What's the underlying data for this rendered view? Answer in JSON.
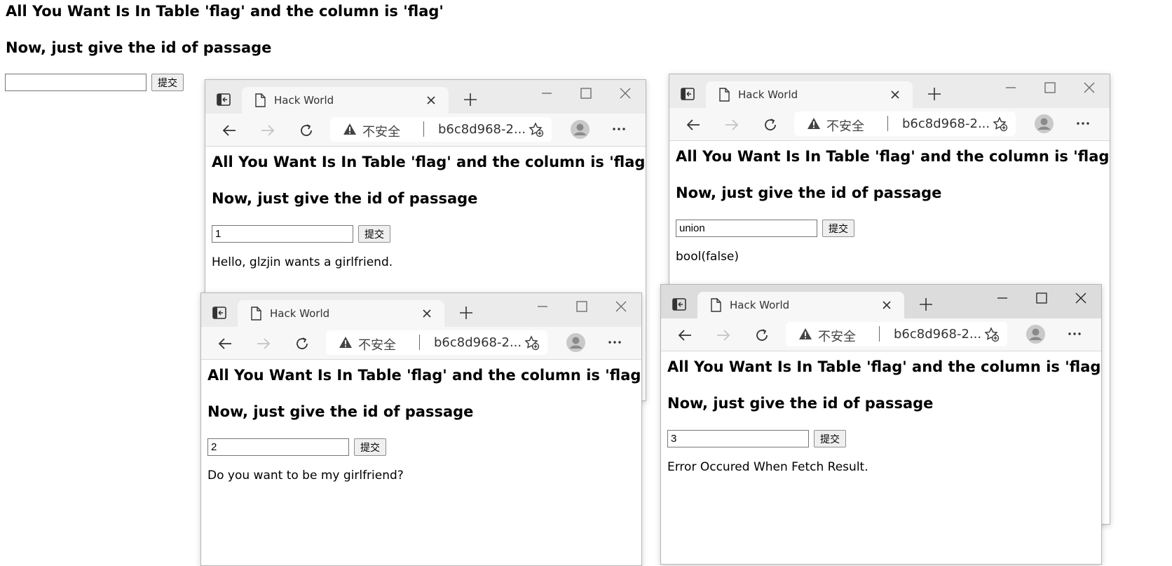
{
  "page": {
    "heading1": "All You Want Is In Table 'flag' and the column is 'flag'",
    "heading2": "Now, just give the id of passage",
    "input_value": "",
    "submit_label": "提交"
  },
  "browser": {
    "tab_title": "Hack World",
    "insecure_label": "不安全",
    "address": "b6c8d968-2...",
    "icons": {
      "tab_actions": "tab-actions-icon",
      "doc": "document-icon",
      "close_tab": "close-icon",
      "new_tab": "plus-icon",
      "minimize": "minimize-icon",
      "maximize": "maximize-icon",
      "close_window": "close-window-icon",
      "back": "back-arrow-icon",
      "forward": "forward-arrow-icon",
      "refresh": "refresh-icon",
      "warning": "warning-icon",
      "favorites": "add-favorite-icon",
      "profile": "profile-avatar-icon",
      "more": "more-icon"
    }
  },
  "windows": [
    {
      "input_value": "1",
      "result": "Hello, glzjin wants a girlfriend."
    },
    {
      "input_value": "union",
      "result": "bool(false)"
    },
    {
      "input_value": "2",
      "result": "Do you want to be my girlfriend?"
    },
    {
      "input_value": "3",
      "result": "Error Occured When Fetch Result."
    }
  ]
}
